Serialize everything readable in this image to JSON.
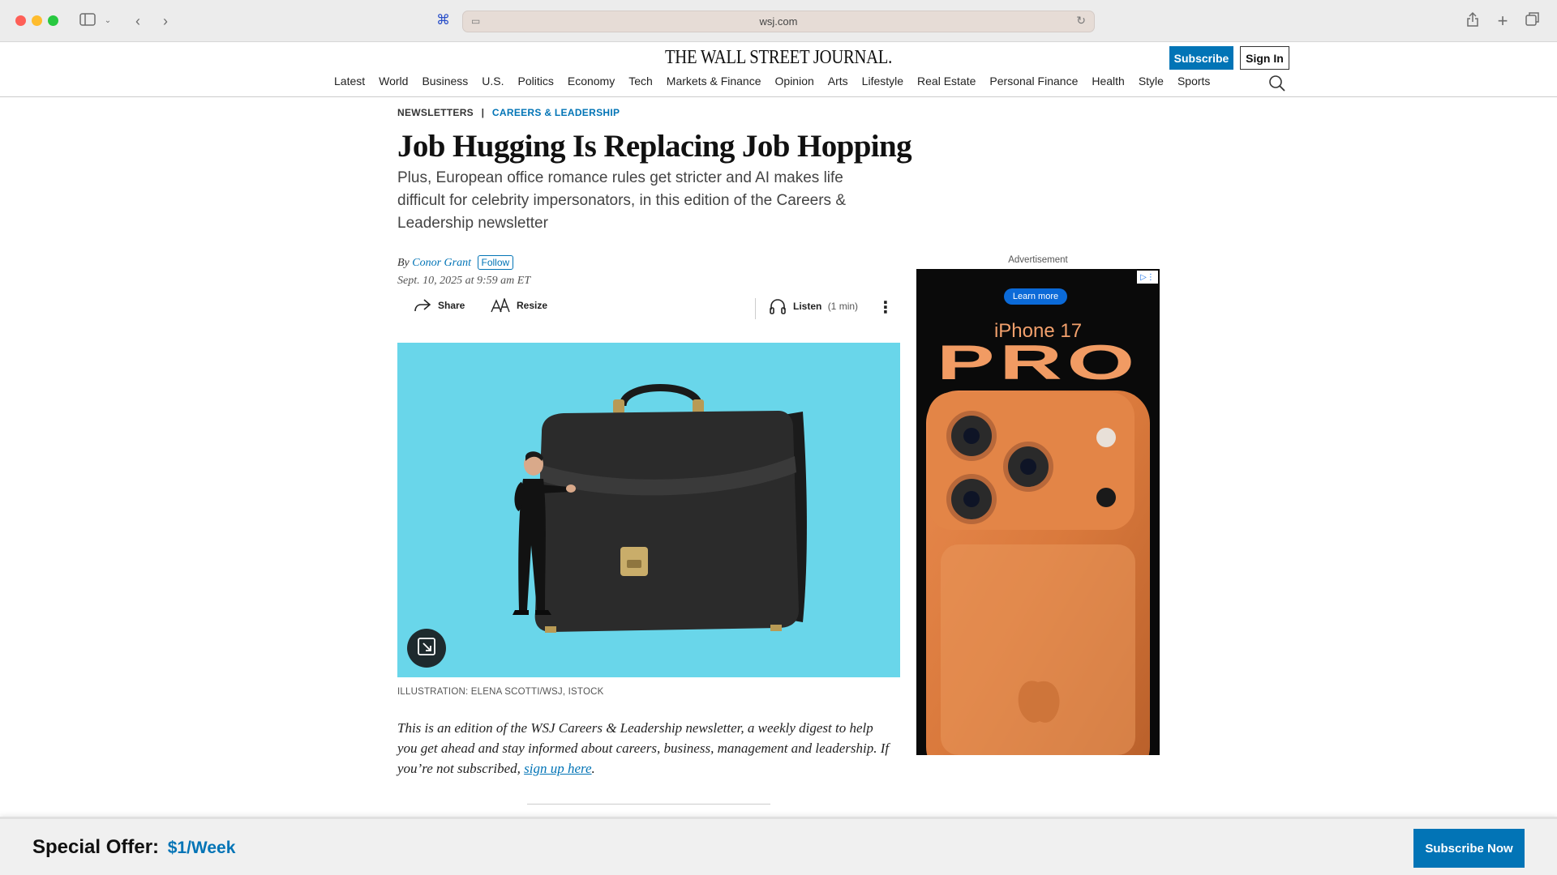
{
  "browser": {
    "url": "wsj.com",
    "icons": [
      "sidebar-icon",
      "chevron-down-icon",
      "back-icon",
      "forward-icon",
      "command-icon",
      "site-settings-icon",
      "reload-icon",
      "share-icon",
      "new-tab-icon",
      "tabs-overview-icon"
    ]
  },
  "header": {
    "logo": "THE WALL STREET JOURNAL.",
    "subscribe_label": "Subscribe",
    "signin_label": "Sign In",
    "nav": [
      "Latest",
      "World",
      "Business",
      "U.S.",
      "Politics",
      "Economy",
      "Tech",
      "Markets & Finance",
      "Opinion",
      "Arts",
      "Lifestyle",
      "Real Estate",
      "Personal Finance",
      "Health",
      "Style",
      "Sports"
    ]
  },
  "article": {
    "flashline_section": "NEWSLETTERS",
    "flashline_separator": "|",
    "flashline_topic": "CAREERS & LEADERSHIP",
    "headline": "Job Hugging Is Replacing Job Hopping",
    "dek": "Plus, European office romance rules get stricter and AI makes life difficult for celebrity impersonators, in this edition of the Careers & Leadership newsletter",
    "byline_prefix": "By",
    "author": "Conor Grant",
    "follow_label": "Follow",
    "timestamp": "Sept. 10, 2025 at 9:59 am ET",
    "share_label": "Share",
    "resize_label": "Resize",
    "listen_label": "Listen",
    "listen_duration": "(1 min)",
    "hero_bg": "#69d6ea",
    "caption": "ILLUSTRATION: ELENA SCOTTI/WSJ, ISTOCK",
    "intro_text": "This is an edition of the WSJ Careers & Leadership newsletter, a weekly digest to help you get ahead and stay informed about careers, business, management and leadership. If you’re not subscribed, ",
    "intro_link": "sign up here",
    "intro_end": "."
  },
  "ad": {
    "label": "Advertisement",
    "learn_more": "Learn more",
    "product": "iPhone 17",
    "product_line": "PRO",
    "accent": "#f19b63"
  },
  "offer": {
    "title": "Special Offer:",
    "price": "$1/Week",
    "cta": "Subscribe Now"
  },
  "colors": {
    "brand_blue": "#0274b6"
  }
}
